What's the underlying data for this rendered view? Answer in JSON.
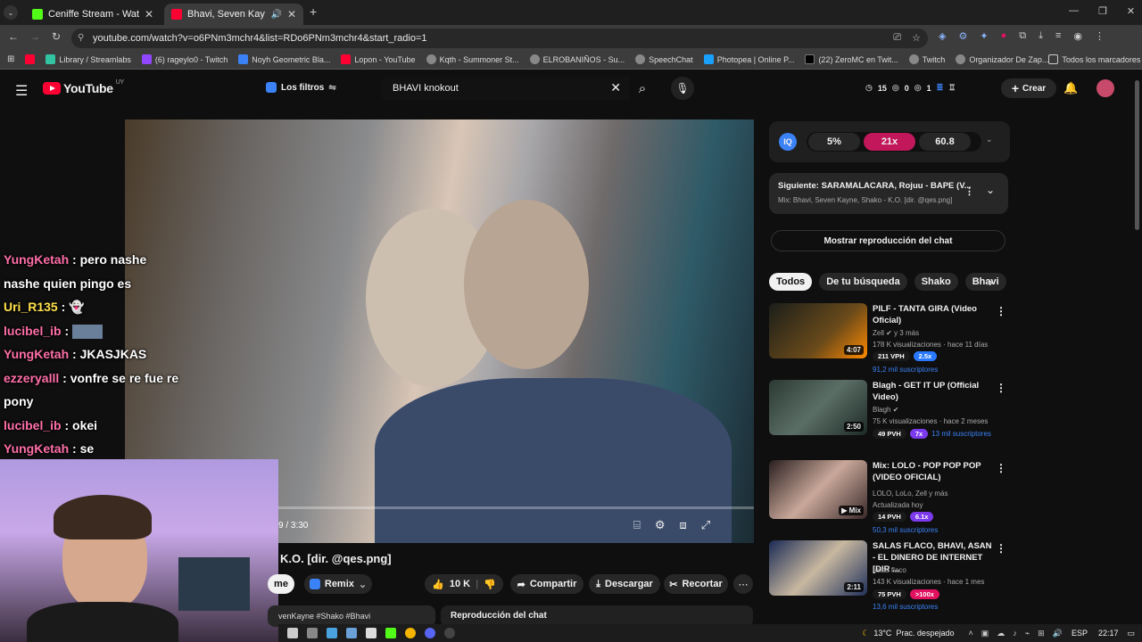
{
  "browser": {
    "tabs": [
      {
        "title": "Ceniffe Stream - Watch Live on ",
        "icon": "kick-icon",
        "active": false
      },
      {
        "title": "Bhavi, Seven Kayne, Shako",
        "icon": "youtube-icon",
        "active": true
      }
    ],
    "url": "youtube.com/watch?v=o6PNm3mchr4&list=RDo6PNm3mchr4&start_radio=1",
    "bookmarks": [
      "Library / Streamlabs",
      "(6) rageylo0 - Twitch",
      "Noyh Geometric Bla...",
      "Lopon - YouTube",
      "Kqth - Summoner St...",
      "ELROBANIÑOS - Su...",
      "SpeechChat",
      "Photopea | Online P...",
      "(22) ZeroMC en Twit...",
      "Twitch",
      "Organizador De Zap..."
    ],
    "bookmarks_folder": "Todos los marcadores"
  },
  "youtube": {
    "logo_text": "YouTube",
    "logo_region": "UY",
    "filters_label": "Los filtros",
    "search_query": "BHAVI knokout",
    "stats": {
      "a": "15",
      "b": "0",
      "c": "1"
    },
    "create_label": "Crear"
  },
  "player": {
    "time": "3:30",
    "time_prefix": "9 / ",
    "title": "K.O. [dir. @qes.png]",
    "remix_label": "Remix",
    "me_label": "me",
    "likes": "10 K",
    "share_label": "Compartir",
    "download_label": "Descargar",
    "clip_label": "Recortar",
    "hashtags": "venKayne #Shako #Bhavi",
    "chat_replay_label": "Reproducción del chat"
  },
  "stream_chat": [
    {
      "user": "YungKetah",
      "color": "#ff6fa8",
      "text": "pero nashe nashe quien pingo es"
    },
    {
      "user": "Uri_R135",
      "color": "#ffe14d",
      "text": ""
    },
    {
      "user": "lucibel_ib",
      "color": "#ff6fa8",
      "text": ""
    },
    {
      "user": "YungKetah",
      "color": "#ff6fa8",
      "text": "JKASJKAS"
    },
    {
      "user": "ezzeryalll",
      "color": "#ff6fa8",
      "text": "vonfre se re fue re pony"
    },
    {
      "user": "lucibel_ib",
      "color": "#ff6fa8",
      "text": "okei"
    },
    {
      "user": "YungKetah",
      "color": "#ff6fa8",
      "text": "se"
    }
  ],
  "sidebar": {
    "ext": {
      "p1": "5%",
      "p2": "21x",
      "p3": "60.8"
    },
    "next": {
      "label": "Siguiente:",
      "title": "SARAMALACARA, Rojuu - BAPE (V...",
      "sub": "Mix: Bhavi, Seven Kayne, Shako - K.O. [dir. @qes.png]"
    },
    "show_chat": "Mostrar reproducción del chat",
    "chips": [
      "Todos",
      "De tu búsqueda",
      "Shako",
      "Bhavi"
    ],
    "recs": [
      {
        "title": "PILF - TANTA GIRA (Video Oficial)",
        "channel": "Zell",
        "meta1": "y 3 más",
        "views": "178 K visualizaciones · hace 11 días",
        "vph": "211 VPH",
        "mult": "2.5x",
        "multc": "#2979ff",
        "subs": "91,2 mil suscriptores",
        "dur": "4:07"
      },
      {
        "title": "Blagh - GET IT UP (Official Video)",
        "channel": "Blagh",
        "meta1": "",
        "views": "75 K visualizaciones · hace 2 meses",
        "vph": "49 PVH",
        "mult": "7x",
        "multc": "#7c3aed",
        "subs": "13 mil suscriptores",
        "dur": "2:50"
      },
      {
        "title": "Mix: LOLO - POP POP POP (VIDEO OFICIAL)",
        "channel": "LOLO, LoLo, Zell y más",
        "meta1": "",
        "views": "Actualizada hoy",
        "vph": "14 PVH",
        "mult": "6.1x",
        "multc": "#7c3aed",
        "subs": "50,3 mil suscriptores",
        "dur": "Mix"
      },
      {
        "title": "SALAS FLACO, BHAVI, ASAN - EL DINERO DE INTERNET [DIR ...",
        "channel": "salas flaco",
        "meta1": "",
        "views": "143 K visualizaciones · hace 1 mes",
        "vph": "75 PVH",
        "mult": ">100x",
        "multc": "#e0115f",
        "subs": "13,6 mil suscriptores",
        "dur": "2:11"
      }
    ]
  },
  "taskbar": {
    "weather": "13°C",
    "weather_desc": "Prac. despejado",
    "lang": "ESP",
    "time": "22:17"
  }
}
